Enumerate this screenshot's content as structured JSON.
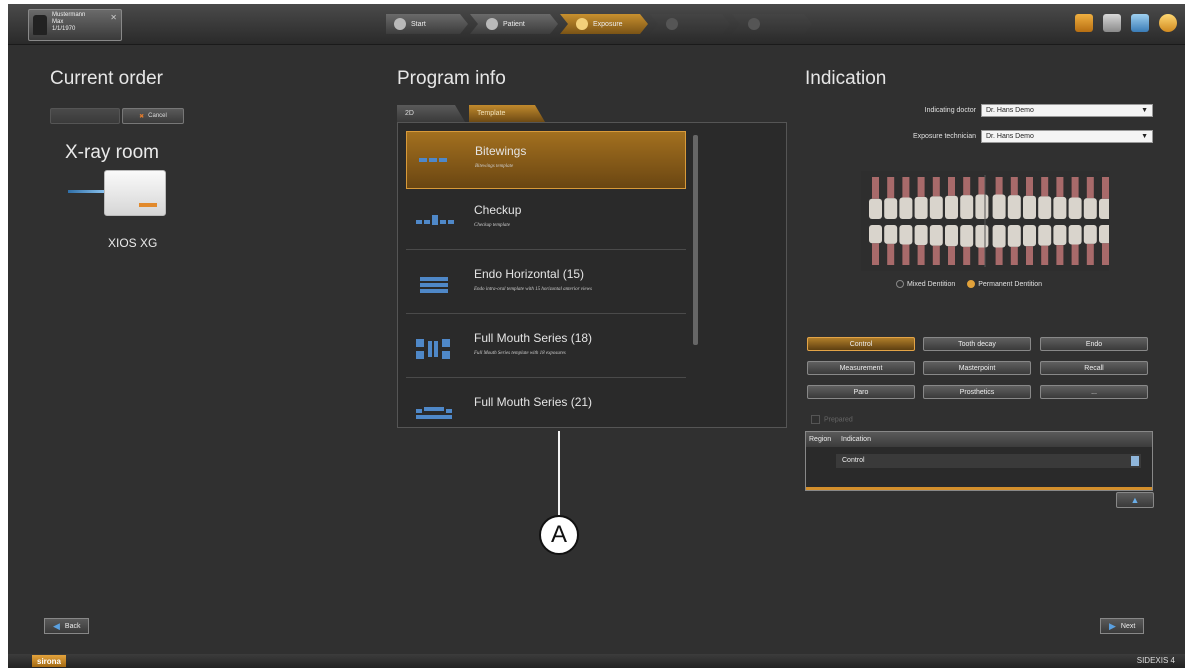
{
  "patient": {
    "name": "Mustermann",
    "first": "Max",
    "dob": "1/1/1970"
  },
  "steps": [
    {
      "label": "Start",
      "state": "done"
    },
    {
      "label": "Patient",
      "state": "done"
    },
    {
      "label": "Exposure",
      "state": "active"
    },
    {
      "label": "",
      "state": "disabled"
    },
    {
      "label": "",
      "state": "disabled"
    }
  ],
  "current_order": {
    "heading": "Current order",
    "start_label": "",
    "cancel_label": "Cancel",
    "room_label": "X-ray room",
    "device_name": "XIOS XG"
  },
  "program_info": {
    "heading": "Program info",
    "tabs": [
      "2D",
      "Template"
    ],
    "items": [
      {
        "name": "Bitewings",
        "desc": "Bitewings template"
      },
      {
        "name": "Checkup",
        "desc": "Checkup template"
      },
      {
        "name": "Endo Horizontal (15)",
        "desc": "Endo intra-oral template with 15 horizontal anterior views"
      },
      {
        "name": "Full Mouth Series (18)",
        "desc": "Full Mouth Series template with 18 exposures"
      },
      {
        "name": "Full Mouth Series (21)",
        "desc": ""
      }
    ]
  },
  "indication": {
    "heading": "Indication",
    "doctor_label": "Indicating doctor",
    "doctor_value": "Dr. Hans Demo",
    "tech_label": "Exposure technician",
    "tech_value": "Dr. Hans Demo",
    "mixed_label": "Mixed Dentition",
    "permanent_label": "Permanent Dentition",
    "buttons": [
      "Control",
      "Tooth decay",
      "Endo",
      "Measurement",
      "Masterpoint",
      "Recall",
      "Paro",
      "Prosthetics",
      "..."
    ],
    "prepared_label": "Prepared",
    "table_headers": [
      "Region",
      "Indication"
    ],
    "table_row": "Control"
  },
  "nav": {
    "back": "Back",
    "next": "Next"
  },
  "callout": {
    "letter": "A"
  },
  "footer": {
    "brand": "sirona",
    "product": "SIDEXIS 4"
  },
  "colors": {
    "accent": "#c8902e",
    "background": "#303030",
    "icon_blue": "#4f88c8"
  }
}
